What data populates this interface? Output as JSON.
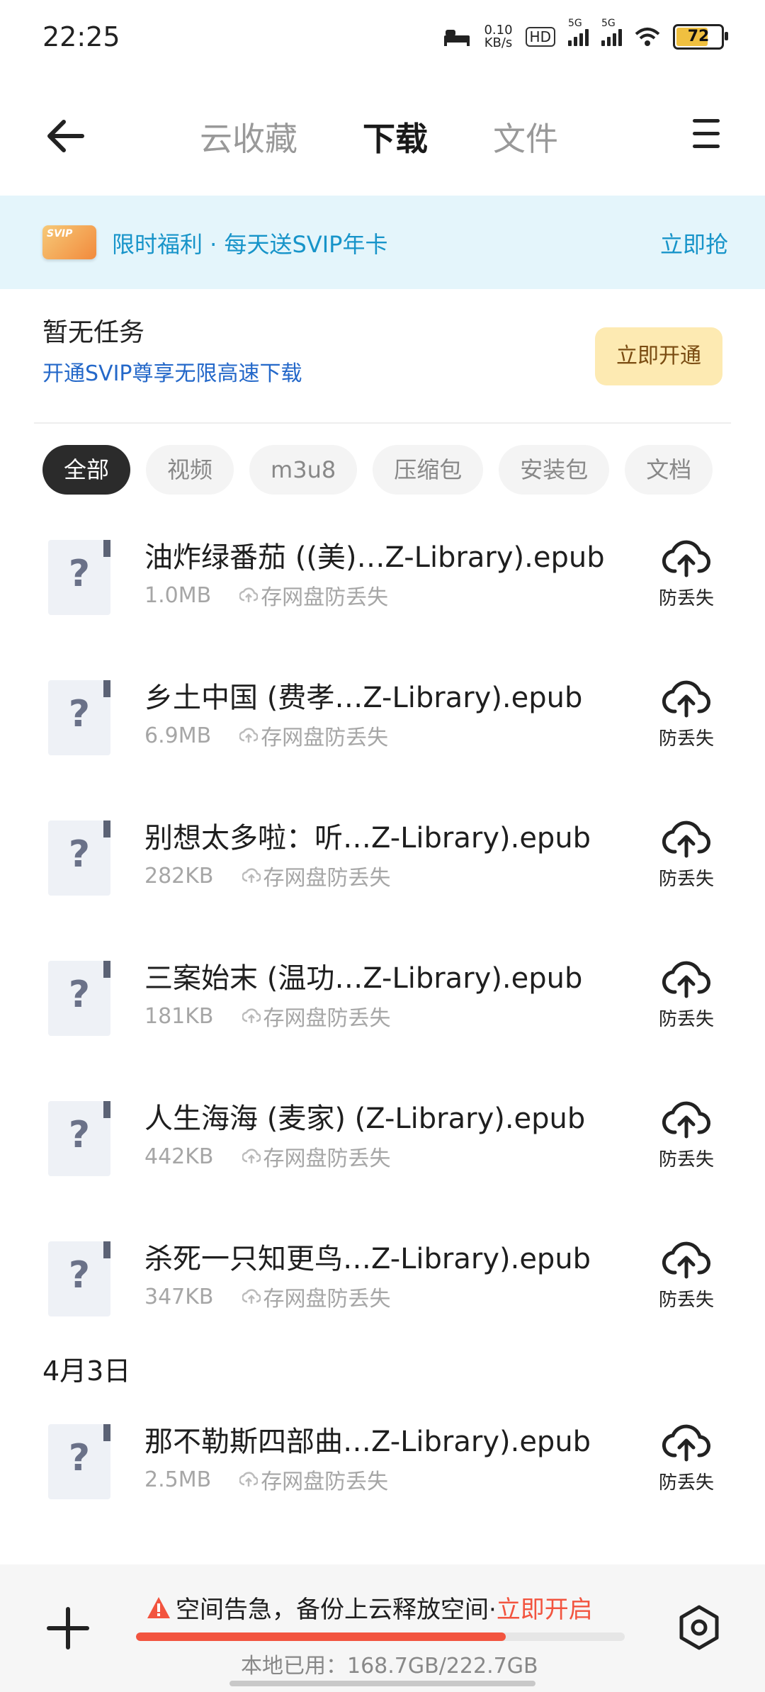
{
  "status": {
    "time": "22:25",
    "net_speed_value": "0.10",
    "net_speed_unit": "KB/s",
    "hd": "HD",
    "sim1": "5G",
    "sim2": "5G",
    "battery": "72"
  },
  "nav": {
    "tabs": [
      {
        "label": "云收藏"
      },
      {
        "label": "下载"
      },
      {
        "label": "文件"
      }
    ]
  },
  "banner": {
    "card_text": "SVIP",
    "text": "限时福利 · 每天送SVIP年卡",
    "action": "立即抢"
  },
  "notask": {
    "title": "暂无任务",
    "subtitle": "开通SVIP尊享无限高速下载",
    "button": "立即开通"
  },
  "filters": [
    "全部",
    "视频",
    "m3u8",
    "压缩包",
    "安装包",
    "文档"
  ],
  "files": [
    {
      "name": "油炸绿番茄 ((美)…Z-Library).epub",
      "size": "1.0MB",
      "hint": "存网盘防丢失",
      "action": "防丢失"
    },
    {
      "name": "乡土中国 (费孝…Z-Library).epub",
      "size": "6.9MB",
      "hint": "存网盘防丢失",
      "action": "防丢失"
    },
    {
      "name": "别想太多啦：听…Z-Library).epub",
      "size": "282KB",
      "hint": "存网盘防丢失",
      "action": "防丢失"
    },
    {
      "name": "三案始末 (温功…Z-Library).epub",
      "size": "181KB",
      "hint": "存网盘防丢失",
      "action": "防丢失"
    },
    {
      "name": "人生海海 (麦家) (Z-Library).epub",
      "size": "442KB",
      "hint": "存网盘防丢失",
      "action": "防丢失"
    },
    {
      "name": "杀死一只知更鸟…Z-Library).epub",
      "size": "347KB",
      "hint": "存网盘防丢失",
      "action": "防丢失"
    }
  ],
  "date_section": "4月3日",
  "files_older": [
    {
      "name": "那不勒斯四部曲…Z-Library).epub",
      "size": "2.5MB",
      "hint": "存网盘防丢失",
      "action": "防丢失"
    }
  ],
  "bottom": {
    "alert_text": "空间告急，备份上云释放空间·",
    "alert_action": "立即开启",
    "usage_text": "本地已用：168.7GB/222.7GB",
    "used_fraction": 0.757
  },
  "colors": {
    "accent_blue": "#1794c9",
    "link_blue": "#2468c9",
    "warning_red": "#f2543f",
    "vip_gold": "#fdeab2"
  }
}
